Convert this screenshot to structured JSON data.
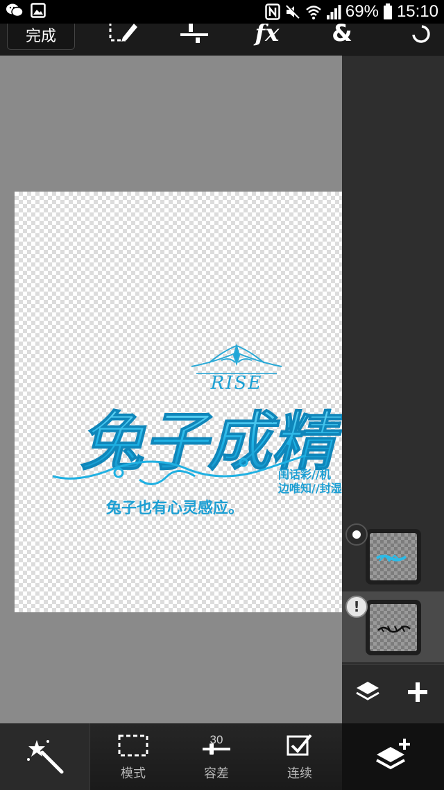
{
  "status_bar": {
    "battery_percent": "69%",
    "time": "15:10",
    "left_icons": [
      "wechat-icon",
      "image-icon"
    ],
    "right_icons": [
      "nfc-icon",
      "mute-icon",
      "wifi-icon",
      "signal-icon",
      "battery-icon"
    ]
  },
  "top_toolbar": {
    "done_label": "完成",
    "tools": [
      "selection-edit-icon",
      "adjust-icon",
      "fx-icon",
      "blend-icon",
      "undo-icon"
    ],
    "fx_label": "fx",
    "blend_label": "&"
  },
  "canvas": {
    "artwork": {
      "logo_text": "RISE",
      "headline": "兔子成精",
      "side_text_1": "闺话彩//机",
      "side_text_2": "边唯知//封湿",
      "subline": "兔子也有心灵感应。",
      "color": "#23b7e5"
    }
  },
  "layers_panel": {
    "layers": [
      {
        "name": "layer-1",
        "selected": false,
        "badge": "visibility-dot",
        "thumb_text": ""
      },
      {
        "name": "layer-2",
        "selected": true,
        "badge": "warning",
        "badge_text": "!",
        "thumb_text": ""
      }
    ],
    "actions": [
      "layers-menu-icon",
      "add-icon"
    ]
  },
  "bottom_toolbar": {
    "active_tool": "magic-wand-icon",
    "options": [
      {
        "label": "模式",
        "icon": "selection-mode-icon",
        "value": ""
      },
      {
        "label": "容差",
        "icon": "tolerance-slider-icon",
        "value": "30"
      },
      {
        "label": "连续",
        "icon": "contiguous-checkbox-icon",
        "value": ""
      }
    ],
    "add_layer_icon": "add-layer-icon"
  }
}
